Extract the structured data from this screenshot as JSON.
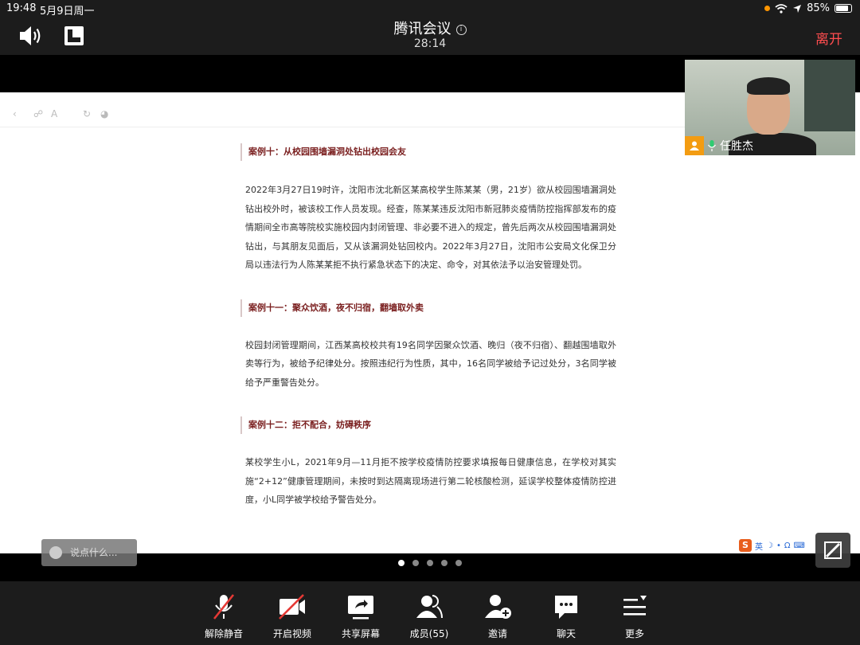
{
  "status": {
    "time": "19:48",
    "date": "5月9日周一",
    "battery": "85%",
    "battery_level": 0.85
  },
  "header": {
    "title": "腾讯会议",
    "timer": "28:14",
    "leave_label": "离开"
  },
  "document": {
    "cases": [
      {
        "title": "案例十：从校园围墙漏洞处钻出校园会友",
        "body": "2022年3月27日19时许，沈阳市沈北新区某高校学生陈某某（男，21岁）欲从校园围墙漏洞处钻出校外时，被该校工作人员发现。经查，陈某某违反沈阳市新冠肺炎疫情防控指挥部发布的疫情期间全市高等院校实施校园内封闭管理、非必要不进入的规定，曾先后两次从校园围墙漏洞处钻出，与其朋友见面后，又从该漏洞处钻回校内。2022年3月27日，沈阳市公安局文化保卫分局以违法行为人陈某某拒不执行紧急状态下的决定、命令，对其依法予以治安管理处罚。"
      },
      {
        "title": "案例十一：聚众饮酒，夜不归宿，翻墙取外卖",
        "body": "校园封闭管理期间，江西某高校校共有19名同学因聚众饮酒、晚归（夜不归宿）、翻越围墙取外卖等行为，被给予纪律处分。按照违纪行为性质，其中，16名同学被给予记过处分，3名同学被给予严重警告处分。"
      },
      {
        "title": "案例十二：拒不配合，妨碍秩序",
        "body": "某校学生小L，2021年9月—11月拒不按学校疫情防控要求填报每日健康信息，在学校对其实施“2+12”健康管理期间，未按时到达隔离现场进行第二轮核酸检测，延误学校整体疫情防控进度，小L同学被学校给予警告处分。"
      }
    ]
  },
  "chat_hint": "说点什么...",
  "ime": {
    "logo": "S",
    "lang": "英"
  },
  "video": {
    "participant_name": "任胜杰"
  },
  "pager": {
    "count": 5,
    "active_index": 0
  },
  "bottom": {
    "unmute": "解除静音",
    "video": "开启视频",
    "share": "共享屏幕",
    "members": "成员(55)",
    "invite": "邀请",
    "chat": "聊天",
    "more": "更多"
  },
  "colors": {
    "leave": "#ff4d4f",
    "case_title": "#7a1f1f",
    "bar_bg": "#1c1c1c",
    "avatar_badge": "#f39c12"
  }
}
